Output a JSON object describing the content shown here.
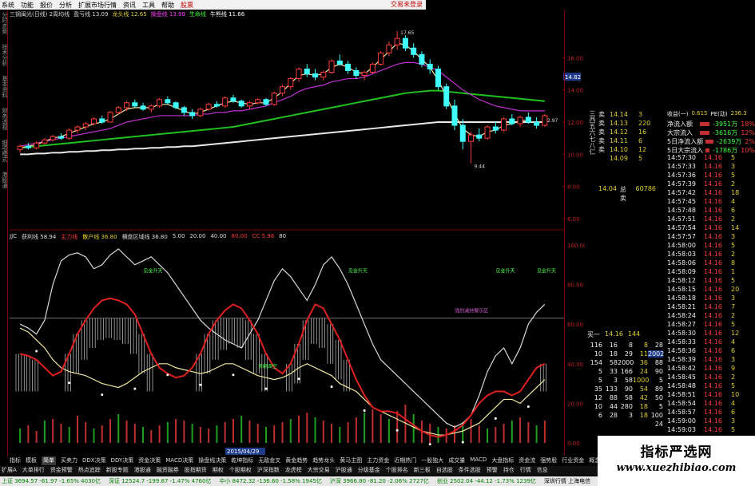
{
  "menu": {
    "items": [
      "系统",
      "功能",
      "报价",
      "分析",
      "扩展市场行情",
      "资讯",
      "工具",
      "帮助"
    ],
    "quote_box": "股票",
    "brand": "交易未登录"
  },
  "left_tabs": [
    "分时走势",
    "技术分析",
    "基本资料",
    "财务透视",
    "细项模式",
    "港股通"
  ],
  "kline": {
    "info": [
      {
        "text": "三钢闽光(日线) 2周均线",
        "color": "#dddddd"
      },
      {
        "text": "盈亏线 13.09",
        "color": "#dddddd"
      },
      {
        "text": "龙头线 12.65",
        "color": "#e0d030"
      },
      {
        "text": "操盘线 13.99",
        "color": "#ff40ff"
      },
      {
        "text": "生命线",
        "color": "#40ff40"
      },
      {
        "text": "牛熊线 11.66",
        "color": "#ffffff"
      }
    ],
    "high_label": "17.65",
    "low_label": "9.44",
    "right_marker": "2.97",
    "price_ticks": [
      "16.00",
      "14.00",
      "12.00",
      "10.00",
      "8.00",
      "6.00"
    ],
    "current_price": "14.82",
    "candles": [
      [
        10.3,
        10.6,
        10.1,
        10.5
      ],
      [
        10.5,
        10.7,
        10.3,
        10.4
      ],
      [
        10.4,
        10.8,
        10.3,
        10.7
      ],
      [
        10.7,
        11.0,
        10.6,
        10.9
      ],
      [
        10.9,
        11.2,
        10.8,
        11.1
      ],
      [
        11.1,
        11.3,
        10.9,
        11.0
      ],
      [
        11.0,
        11.6,
        10.9,
        11.5
      ],
      [
        11.5,
        11.8,
        11.3,
        11.7
      ],
      [
        11.7,
        12.0,
        11.5,
        11.9
      ],
      [
        11.9,
        12.3,
        11.8,
        12.2
      ],
      [
        12.2,
        12.4,
        11.9,
        12.0
      ],
      [
        12.0,
        12.7,
        12.0,
        12.6
      ],
      [
        12.6,
        13.0,
        12.5,
        12.9
      ],
      [
        12.9,
        13.3,
        12.7,
        13.2
      ],
      [
        13.2,
        13.4,
        12.9,
        13.0
      ],
      [
        13.0,
        13.2,
        12.7,
        12.8
      ],
      [
        12.8,
        13.1,
        12.6,
        13.0
      ],
      [
        13.0,
        13.5,
        12.9,
        13.4
      ],
      [
        13.4,
        13.6,
        13.1,
        13.2
      ],
      [
        13.2,
        13.3,
        12.8,
        12.9
      ],
      [
        12.9,
        13.0,
        12.4,
        12.6
      ],
      [
        12.6,
        12.8,
        12.2,
        12.4
      ],
      [
        12.4,
        12.9,
        12.3,
        12.8
      ],
      [
        12.8,
        13.2,
        12.7,
        13.1
      ],
      [
        13.1,
        13.3,
        12.9,
        13.0
      ],
      [
        13.0,
        13.6,
        12.9,
        13.5
      ],
      [
        13.5,
        13.7,
        13.2,
        13.3
      ],
      [
        13.3,
        13.4,
        12.9,
        13.0
      ],
      [
        13.0,
        13.3,
        12.8,
        13.2
      ],
      [
        13.2,
        13.5,
        13.1,
        13.4
      ],
      [
        13.4,
        13.5,
        13.0,
        13.1
      ],
      [
        13.1,
        13.9,
        13.0,
        13.8
      ],
      [
        13.8,
        14.3,
        13.6,
        14.2
      ],
      [
        14.2,
        14.8,
        14.0,
        14.7
      ],
      [
        14.7,
        15.4,
        14.5,
        15.3
      ],
      [
        15.3,
        15.6,
        14.8,
        15.0
      ],
      [
        15.0,
        15.3,
        14.6,
        14.8
      ],
      [
        14.8,
        15.2,
        14.6,
        15.1
      ],
      [
        15.1,
        15.9,
        15.0,
        15.8
      ],
      [
        15.8,
        16.2,
        15.5,
        15.6
      ],
      [
        15.6,
        15.8,
        15.0,
        15.2
      ],
      [
        15.2,
        15.4,
        14.7,
        14.9
      ],
      [
        14.9,
        15.2,
        14.6,
        15.1
      ],
      [
        15.1,
        15.7,
        15.0,
        15.6
      ],
      [
        15.6,
        16.4,
        15.5,
        16.3
      ],
      [
        16.3,
        17.0,
        16.1,
        16.8
      ],
      [
        16.8,
        17.65,
        16.5,
        17.2
      ],
      [
        17.2,
        17.4,
        16.4,
        16.6
      ],
      [
        16.6,
        16.9,
        16.0,
        16.2
      ],
      [
        16.2,
        16.4,
        15.4,
        15.6
      ],
      [
        15.6,
        15.9,
        15.0,
        15.3
      ],
      [
        15.3,
        15.5,
        14.0,
        14.2
      ],
      [
        14.2,
        14.4,
        12.8,
        13.0
      ],
      [
        13.0,
        13.4,
        11.5,
        11.8
      ],
      [
        11.8,
        12.2,
        10.3,
        10.8
      ],
      [
        10.8,
        11.4,
        9.44,
        11.2
      ],
      [
        11.2,
        11.6,
        10.8,
        11.0
      ],
      [
        11.0,
        11.8,
        10.9,
        11.7
      ],
      [
        11.7,
        12.0,
        11.3,
        11.5
      ],
      [
        11.5,
        12.3,
        11.4,
        12.2
      ],
      [
        12.2,
        12.5,
        11.8,
        11.9
      ],
      [
        11.9,
        12.4,
        11.7,
        12.3
      ],
      [
        12.3,
        12.6,
        11.9,
        12.0
      ],
      [
        12.0,
        12.3,
        11.6,
        11.8
      ],
      [
        11.8,
        12.5,
        11.7,
        12.4
      ]
    ],
    "ma_white": [
      10.0,
      10.0,
      10.05,
      10.05,
      10.1,
      10.1,
      10.15,
      10.15,
      10.2,
      10.2,
      10.25,
      10.25,
      10.3,
      10.3,
      10.35,
      10.35,
      10.4,
      10.4,
      10.45,
      10.45,
      10.5,
      10.5,
      10.55,
      10.6,
      10.65,
      10.7,
      10.75,
      10.8,
      10.85,
      10.9,
      10.95,
      11.0,
      11.05,
      11.1,
      11.15,
      11.2,
      11.25,
      11.3,
      11.35,
      11.4,
      11.45,
      11.5,
      11.55,
      11.6,
      11.65,
      11.7,
      11.75,
      11.8,
      11.85,
      11.9,
      11.95,
      12.0,
      12.0,
      12.0,
      12.0,
      12.0,
      12.0,
      12.0,
      12.0,
      12.0,
      12.0,
      12.0,
      12.0,
      12.0,
      12.0
    ],
    "ma_green": [
      10.4,
      10.45,
      10.5,
      10.55,
      10.6,
      10.65,
      10.7,
      10.75,
      10.8,
      10.85,
      10.9,
      10.95,
      11.0,
      11.05,
      11.1,
      11.15,
      11.2,
      11.25,
      11.3,
      11.35,
      11.4,
      11.45,
      11.5,
      11.55,
      11.6,
      11.65,
      11.7,
      11.8,
      11.9,
      12.0,
      12.1,
      12.2,
      12.3,
      12.4,
      12.5,
      12.6,
      12.7,
      12.8,
      12.9,
      13.0,
      13.1,
      13.2,
      13.3,
      13.4,
      13.5,
      13.6,
      13.7,
      13.8,
      13.85,
      13.9,
      13.95,
      13.95,
      13.9,
      13.85,
      13.8,
      13.75,
      13.7,
      13.65,
      13.6,
      13.55,
      13.5,
      13.45,
      13.4,
      13.35,
      13.3
    ],
    "ma_magenta": [
      10.5,
      10.6,
      10.7,
      10.8,
      10.9,
      11.0,
      11.1,
      11.2,
      11.3,
      11.4,
      11.5,
      11.6,
      11.8,
      12.0,
      12.1,
      12.2,
      12.3,
      12.4,
      12.4,
      12.4,
      12.4,
      12.4,
      12.5,
      12.5,
      12.6,
      12.6,
      12.7,
      12.7,
      12.8,
      12.9,
      13.0,
      13.2,
      13.4,
      13.6,
      13.9,
      14.1,
      14.2,
      14.3,
      14.5,
      14.6,
      14.7,
      14.7,
      14.8,
      15.0,
      15.2,
      15.4,
      15.6,
      15.7,
      15.7,
      15.6,
      15.4,
      15.2,
      14.8,
      14.4,
      14.0,
      13.7,
      13.4,
      13.2,
      13.0,
      12.9,
      12.8,
      12.7,
      12.7,
      12.7,
      12.7
    ],
    "ma_yellow": [
      10.4,
      10.5,
      10.6,
      10.8,
      11.0,
      11.1,
      11.3,
      11.5,
      11.7,
      11.9,
      12.0,
      12.2,
      12.5,
      12.8,
      12.9,
      12.9,
      12.9,
      13.1,
      13.1,
      12.9,
      12.7,
      12.5,
      12.6,
      12.8,
      13.0,
      13.2,
      13.3,
      13.2,
      13.1,
      13.2,
      13.2,
      13.5,
      13.9,
      14.4,
      14.9,
      15.0,
      14.9,
      15.0,
      15.4,
      15.6,
      15.4,
      15.1,
      15.0,
      15.4,
      15.9,
      16.4,
      16.9,
      16.8,
      16.4,
      15.9,
      15.4,
      14.6,
      13.6,
      12.5,
      11.6,
      11.2,
      11.1,
      11.4,
      11.5,
      11.8,
      11.9,
      12.1,
      12.1,
      11.9,
      12.1
    ]
  },
  "indicator": {
    "header": [
      {
        "text": "JJC",
        "color": "#dddddd"
      },
      {
        "text": "获利线 58.94",
        "color": "#dddddd"
      },
      {
        "text": "主力线",
        "color": "#ff3b3b"
      },
      {
        "text": "散户线 36.80",
        "color": "#e0d030"
      },
      {
        "text": "横盘区域线 36.80",
        "color": "#dddddd"
      },
      {
        "text": "5.00",
        "color": "#dddddd"
      },
      {
        "text": "20.00",
        "color": "#dddddd"
      },
      {
        "text": "40.00",
        "color": "#dddddd"
      },
      {
        "text": "80.00",
        "color": "#ff3b3b"
      },
      {
        "text": "CC 5.98",
        "color": "#ff3b3b"
      },
      {
        "text": "80",
        "color": "#dddddd"
      }
    ],
    "ticks": [
      "100.00",
      "80.00",
      "60.00",
      "40.00",
      "20.00",
      "0.00"
    ],
    "annotations": [
      "见金升天",
      "见金升天",
      "见金升天",
      "见金升天",
      "强烈减持警示区",
      "多翻调空"
    ],
    "date_box": "2015/04/29",
    "white_line": [
      60,
      58,
      55,
      62,
      80,
      92,
      95,
      96,
      94,
      88,
      90,
      95,
      98,
      94,
      90,
      92,
      94,
      90,
      86,
      80,
      74,
      68,
      62,
      58,
      55,
      52,
      50,
      48,
      55,
      62,
      72,
      82,
      88,
      84,
      78,
      72,
      80,
      90,
      94,
      88,
      80,
      70,
      60,
      50,
      42,
      38,
      34,
      30,
      26,
      22,
      18,
      14,
      10,
      8,
      10,
      14,
      24,
      36,
      44,
      48,
      40,
      48,
      60,
      66,
      70
    ],
    "red_line": [
      45,
      44,
      42,
      38,
      34,
      36,
      45,
      55,
      62,
      68,
      72,
      73,
      72,
      70,
      65,
      55,
      45,
      38,
      35,
      33,
      34,
      38,
      45,
      55,
      62,
      67,
      70,
      68,
      62,
      55,
      45,
      38,
      35,
      40,
      50,
      62,
      70,
      68,
      60,
      52,
      42,
      32,
      24,
      18,
      16,
      16,
      15,
      12,
      9,
      6,
      4,
      3,
      4,
      6,
      9,
      14,
      20,
      24,
      26,
      26,
      24,
      26,
      32,
      38,
      40
    ],
    "yellow_line": [
      58,
      56,
      52,
      48,
      42,
      38,
      36,
      35,
      34,
      32,
      30,
      29,
      28,
      30,
      33,
      36,
      38,
      40,
      40,
      38,
      37,
      36,
      35,
      36,
      38,
      40,
      40,
      38,
      36,
      34,
      33,
      32,
      33,
      35,
      38,
      40,
      38,
      36,
      34,
      30,
      28,
      26,
      22,
      18,
      16,
      14,
      12,
      10,
      8,
      6,
      5,
      4,
      4,
      5,
      6,
      8,
      10,
      14,
      18,
      22,
      22,
      20,
      24,
      28,
      32
    ],
    "volume": [
      18,
      22,
      15,
      28,
      30,
      24,
      20,
      34,
      26,
      18,
      22,
      30,
      36,
      28,
      24,
      20,
      16,
      22,
      26,
      30,
      28,
      24,
      20,
      18,
      22,
      26,
      30,
      34,
      28,
      24,
      20,
      22,
      26,
      30,
      34,
      38,
      32,
      28,
      24,
      20,
      26,
      32,
      38,
      42,
      36,
      30,
      40,
      48,
      36,
      28,
      24,
      20,
      18,
      22,
      26,
      30,
      22,
      18,
      20,
      24,
      28,
      32,
      26,
      22,
      28
    ]
  },
  "quote": {
    "title": "三钢闽光",
    "left_code": "三西五六七八仁",
    "top_rows": [
      {
        "l": "卖",
        "p": "14.14",
        "v": "3"
      },
      {
        "l": "卖",
        "p": "14.13",
        "v": "220"
      },
      {
        "l": "卖",
        "p": "14.12",
        "v": "16"
      },
      {
        "l": "卖",
        "p": "14.11",
        "v": "6"
      },
      {
        "l": "卖",
        "p": "14.10",
        "v": "12"
      },
      {
        "l": "",
        "p": "14.09",
        "v": "5"
      }
    ],
    "total_sell_label": "总卖",
    "total_sell_value": "60786",
    "total_price": "14.04",
    "flow_header": [
      "收益(一)",
      "0.615",
      "PE(动)",
      "236.3"
    ],
    "flow_rows": [
      {
        "name": "净流入额",
        "val": "-3951万",
        "pct": "18%"
      },
      {
        "name": "大宗流入",
        "val": "-3616万",
        "pct": "12%"
      },
      {
        "name": "5日净流入额",
        "val": "-2639万",
        "pct": "2%"
      },
      {
        "name": "5日大宗流入",
        "val": "-1786万",
        "pct": "10%"
      }
    ],
    "buy_header": {
      "label": "买一",
      "price": "14.16",
      "vol": "144"
    },
    "depth_rows": [
      [
        "116",
        "16",
        "8",
        "8",
        "28"
      ],
      [
        "10",
        "18",
        "29",
        "11",
        "2002"
      ],
      [
        "154",
        "58",
        "2000",
        "36",
        "88"
      ],
      [
        "5",
        "33",
        "166",
        "24",
        "90"
      ],
      [
        "5",
        "3",
        "58",
        "1000",
        "5"
      ],
      [
        "35",
        "133",
        "90",
        "54",
        "89"
      ],
      [
        "12",
        "88",
        "58",
        "42",
        "50"
      ],
      [
        "10",
        "44",
        "280",
        "18",
        "5"
      ],
      [
        "6",
        "28",
        "3",
        "18",
        "100"
      ],
      [
        "",
        "",
        "",
        "",
        "24"
      ]
    ],
    "ticks": [
      {
        "t": "14:57:30",
        "p": "14.16",
        "v": "5"
      },
      {
        "t": "14:57:33",
        "p": "14.16",
        "v": "3"
      },
      {
        "t": "14:57:36",
        "p": "14.16",
        "v": "5"
      },
      {
        "t": "14:57:39",
        "p": "14.16",
        "v": "2"
      },
      {
        "t": "14:57:42",
        "p": "14.16",
        "v": "18"
      },
      {
        "t": "14:57:45",
        "p": "14.16",
        "v": "4"
      },
      {
        "t": "14:57:48",
        "p": "14.16",
        "v": "6"
      },
      {
        "t": "14:57:51",
        "p": "14.16",
        "v": "2"
      },
      {
        "t": "14:57:54",
        "p": "14.16",
        "v": "14"
      },
      {
        "t": "14:57:57",
        "p": "14.16",
        "v": "3"
      },
      {
        "t": "14:58:00",
        "p": "14.16",
        "v": "5"
      },
      {
        "t": "14:58:03",
        "p": "14.16",
        "v": "2"
      },
      {
        "t": "14:58:06",
        "p": "14.16",
        "v": "8"
      },
      {
        "t": "14:58:09",
        "p": "14.16",
        "v": "1"
      },
      {
        "t": "14:58:12",
        "p": "14.16",
        "v": "5"
      },
      {
        "t": "14:58:15",
        "p": "14.16",
        "v": "20"
      },
      {
        "t": "14:58:18",
        "p": "14.16",
        "v": "3"
      },
      {
        "t": "14:58:21",
        "p": "14.16",
        "v": "7"
      },
      {
        "t": "14:58:24",
        "p": "14.16",
        "v": "2"
      },
      {
        "t": "14:58:27",
        "p": "14.16",
        "v": "5"
      },
      {
        "t": "14:58:30",
        "p": "14.16",
        "v": "12"
      },
      {
        "t": "14:58:33",
        "p": "14.16",
        "v": "4"
      },
      {
        "t": "14:58:36",
        "p": "14.16",
        "v": "6"
      },
      {
        "t": "14:58:39",
        "p": "14.16",
        "v": "3"
      },
      {
        "t": "14:58:42",
        "p": "14.16",
        "v": "9"
      },
      {
        "t": "14:58:45",
        "p": "14.16",
        "v": "2"
      },
      {
        "t": "14:58:48",
        "p": "14.16",
        "v": "5"
      },
      {
        "t": "14:58:51",
        "p": "14.16",
        "v": "10"
      },
      {
        "t": "14:58:54",
        "p": "14.16",
        "v": "4"
      },
      {
        "t": "14:58:57",
        "p": "14.16",
        "v": "6"
      },
      {
        "t": "14:59:00",
        "p": "14.16",
        "v": "3"
      },
      {
        "t": "14:59:03",
        "p": "14.16",
        "v": "5"
      },
      {
        "t": "14:59:06",
        "p": "14.16",
        "v": "8"
      }
    ]
  },
  "bottom_tabs": [
    "指标",
    "模板",
    "简单",
    "买卖力",
    "DDX决策",
    "DDY决策",
    "资金决策",
    "MACD决策",
    "操盘线决策",
    "乾坤指标",
    "无敌金叉",
    "黄金趋势",
    "趋势龙头",
    "黄马主图",
    "主力资金",
    "近期热门",
    "一股独大",
    "成交量",
    "MACD",
    "大盘指标",
    "资金流",
    "强势股",
    "行业资金",
    "概念板块",
    "主力流入"
  ],
  "bottom_active": 2,
  "footer_tabs": [
    "扩展A",
    "大单排行",
    "资金预警",
    "热点追踪",
    "新股专题",
    "港股通",
    "融资融券",
    "股指期货",
    "期权",
    "个股期权",
    "沪深指数",
    "龙虎榜",
    "大宗交易",
    "沪股通",
    "分级基金",
    "个股排名",
    "新三板",
    "自选股",
    "条件选股",
    "预警",
    "持仓",
    "行情",
    "信息"
  ],
  "status": {
    "items": [
      {
        "text": "上证 3694.57 -61.97 -1.65% 4030亿",
        "color": "#008000"
      },
      {
        "text": "深证 12524.7 -199.87 -1.47% 4760亿",
        "color": "#008000"
      },
      {
        "text": "中小 8472.32 -136.60 -1.58% 1945亿",
        "color": "#008000"
      },
      {
        "text": "沪深 3966.80 -81.20 -2.06% 2727亿",
        "color": "#008000"
      },
      {
        "text": "创业 2502.04 -44.12 -1.73% 1239亿",
        "color": "#008000"
      },
      {
        "text": "深圳行情 上海电信",
        "color": "#000000"
      }
    ]
  },
  "watermark": {
    "title": "指标严选网",
    "url": "www.xuezhibiao.com"
  },
  "colors": {
    "up": "#ff3b3b",
    "down": "#40ffff",
    "ma_white": "#e8e8e8",
    "ma_green": "#20c020",
    "ma_magenta": "#c030d0",
    "ma_yellow": "#f0e0a0",
    "grid_red": "#800000"
  }
}
